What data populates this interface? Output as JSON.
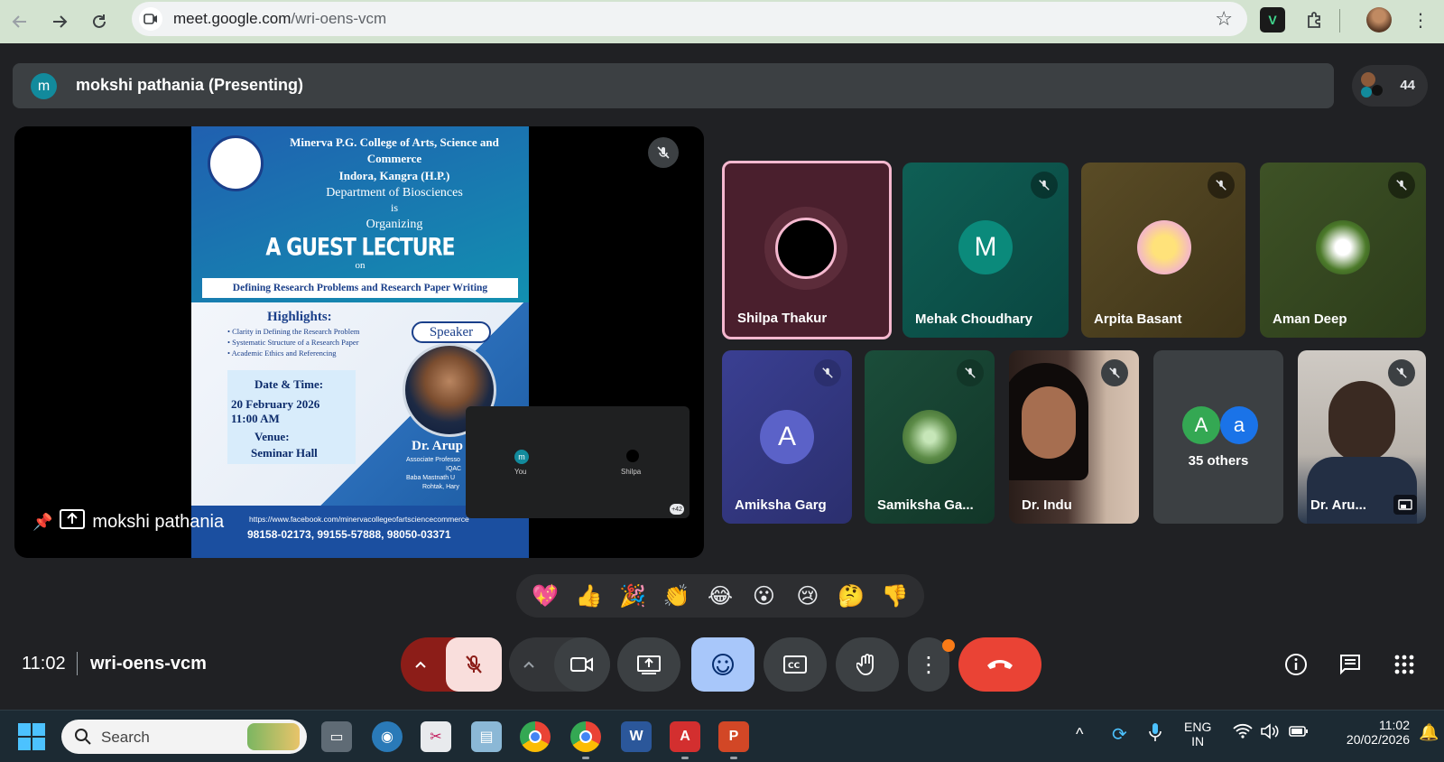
{
  "browser": {
    "url_host": "meet.google.com",
    "url_path": "/wri-oens-vcm"
  },
  "header": {
    "presenter_initial": "m",
    "presenting_title": "mokshi pathania (Presenting)",
    "people_count": "44"
  },
  "slide": {
    "college_line1": "Minerva P.G. College of Arts, Science and",
    "college_line2": "Commerce",
    "college_line3": "Indora, Kangra (H.P.)",
    "dept": "Department of Biosciences",
    "is": "is",
    "organizing": "Organizing",
    "guest_lecture": "A GUEST LECTURE",
    "on": "on",
    "topic": "Defining Research Problems and Research Paper Writing",
    "highlights_title": "Highlights:",
    "highlights": [
      "• Clarity in Defining the Research Problem",
      "• Systematic Structure of a Research Paper",
      "• Academic Ethics and Referencing"
    ],
    "date_label": "Date & Time:",
    "date": "20 February 2026",
    "time": "11:00 AM",
    "venue_label": "Venue:",
    "venue": "Seminar Hall",
    "speaker_tag": "Speaker",
    "speaker_name": "Dr. Arup",
    "speaker_role1": "Associate Professo",
    "speaker_role2": "IQAC",
    "speaker_role3": "Baba Mastnath U",
    "speaker_role4": "Rohtak, Hary",
    "facebook": "https://www.facebook.com/minervacollegeofartsciencecommerce",
    "phones": "98158-02173, 99155-57888, 98050-03371"
  },
  "mini_tile": {
    "you_initial": "m",
    "you_label": "You",
    "shilpa_label": "Shilpa",
    "more_count": "+42"
  },
  "stage_label": "mokshi pathania",
  "participants": [
    {
      "name": "Shilpa Thakur"
    },
    {
      "name": "Mehak Choudhary",
      "initial": "M"
    },
    {
      "name": "Arpita Basant"
    },
    {
      "name": "Aman Deep"
    },
    {
      "name": "Amiksha Garg",
      "initial": "A"
    },
    {
      "name": "Samiksha Ga..."
    },
    {
      "name": "Dr. Indu"
    },
    {
      "name": "35 others",
      "initial1": "A",
      "initial2": "a"
    },
    {
      "name": "Dr. Aru..."
    }
  ],
  "reactions": [
    "💖",
    "👍",
    "🎉",
    "👏",
    "😂",
    "😮",
    "😢",
    "🤔",
    "👎"
  ],
  "footer": {
    "time": "11:02",
    "meeting_code": "wri-oens-vcm"
  },
  "taskbar": {
    "search_placeholder": "Search",
    "lang_line1": "ENG",
    "lang_line2": "IN",
    "clock_time": "11:02",
    "clock_date": "20/02/2026"
  },
  "colors": {
    "end_call": "#ea4335",
    "reactions_active": "#a8c7fa",
    "mic_off_bg": "#f9dedc",
    "active_speaker_border": "#f5b8cf"
  }
}
